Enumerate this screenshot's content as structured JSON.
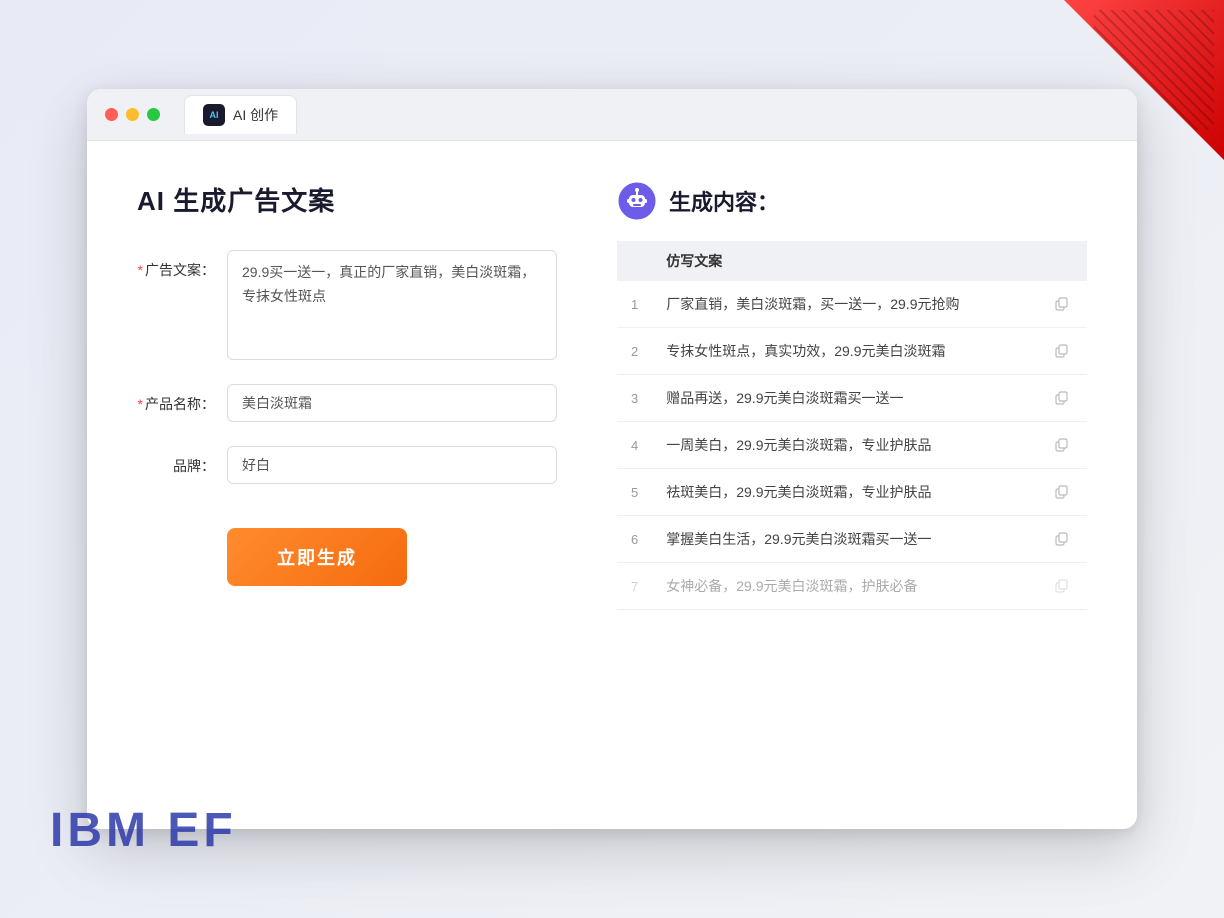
{
  "window": {
    "tab_label": "AI 创作",
    "tab_icon_text": "AI"
  },
  "left": {
    "page_title": "AI 生成广告文案",
    "form": {
      "ad_copy_label": "广告文案：",
      "ad_copy_required": "＊",
      "ad_copy_value": "29.9买一送一，真正的厂家直销，美白淡斑霜，专抹女性斑点",
      "product_name_label": "产品名称：",
      "product_name_required": "＊",
      "product_name_value": "美白淡斑霜",
      "brand_label": "品牌：",
      "brand_value": "好白",
      "generate_button": "立即生成"
    }
  },
  "right": {
    "title": "生成内容：",
    "table": {
      "column_label": "仿写文案",
      "rows": [
        {
          "num": "1",
          "text": "厂家直销，美白淡斑霜，买一送一，29.9元抢购"
        },
        {
          "num": "2",
          "text": "专抹女性斑点，真实功效，29.9元美白淡斑霜"
        },
        {
          "num": "3",
          "text": "赠品再送，29.9元美白淡斑霜买一送一"
        },
        {
          "num": "4",
          "text": "一周美白，29.9元美白淡斑霜，专业护肤品"
        },
        {
          "num": "5",
          "text": "祛斑美白，29.9元美白淡斑霜，专业护肤品"
        },
        {
          "num": "6",
          "text": "掌握美白生活，29.9元美白淡斑霜买一送一"
        },
        {
          "num": "7",
          "text": "女神必备，29.9元美白淡斑霜，护肤必备"
        }
      ]
    }
  },
  "decoration": {
    "ibm_ef_text": "IBM EF"
  }
}
